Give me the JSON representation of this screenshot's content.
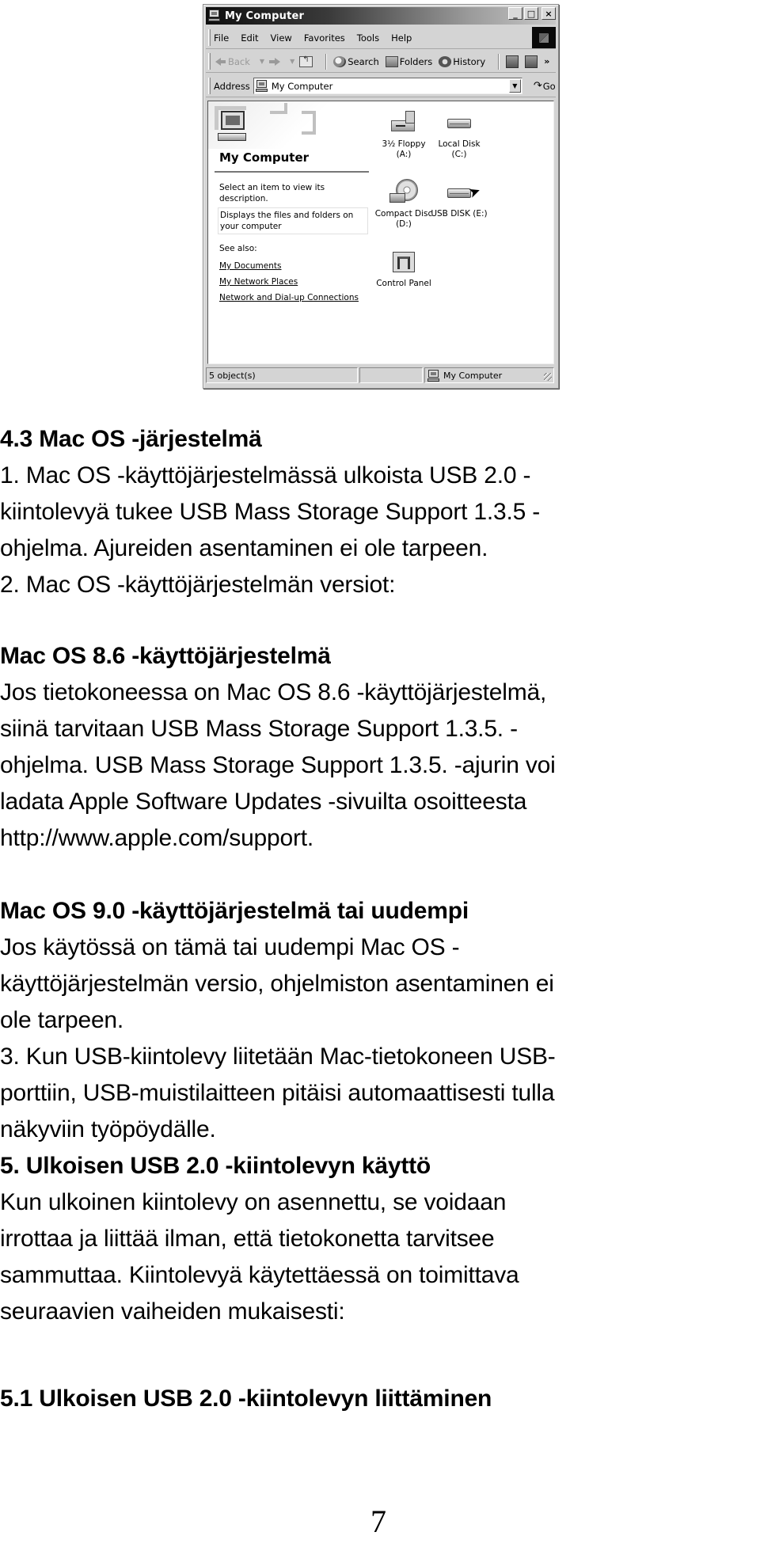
{
  "window": {
    "title": "My Computer",
    "controls": {
      "minimize": "_",
      "maximize": "□",
      "close": "×"
    },
    "menu": [
      "File",
      "Edit",
      "View",
      "Favorites",
      "Tools",
      "Help"
    ],
    "toolbar": {
      "back": "Back",
      "search": "Search",
      "folders": "Folders",
      "history": "History",
      "more": "»"
    },
    "address": {
      "label": "Address",
      "value": "My Computer",
      "go": "Go"
    },
    "left_pane": {
      "title": "My Computer",
      "hint": "Select an item to view its description.",
      "description": "Displays the files and folders on your computer",
      "see_also_label": "See also:",
      "links": [
        "My Documents",
        "My Network Places",
        "Network and Dial-up Connections"
      ]
    },
    "drives": [
      {
        "label": "3½ Floppy (A:)",
        "icon": "floppy-drive-icon"
      },
      {
        "label": "Local Disk (C:)",
        "icon": "hard-disk-icon"
      },
      {
        "label": "Compact Disc (D:)",
        "icon": "cd-drive-icon"
      },
      {
        "label": "USB DISK (E:)",
        "icon": "usb-disk-icon"
      },
      {
        "label": "Control Panel",
        "icon": "control-panel-icon"
      }
    ],
    "status": {
      "objects": "5 object(s)",
      "location": "My Computer"
    }
  },
  "document": {
    "lines": [
      {
        "text": "4.3 Mac OS -järjestelmä",
        "bold": true
      },
      {
        "text": "1. Mac OS -käyttöjärjestelmässä ulkoista USB 2.0 -",
        "bold": false
      },
      {
        "text": "kiintolevyä tukee USB Mass Storage Support 1.3.5 -",
        "bold": false
      },
      {
        "text": "ohjelma. Ajureiden asentaminen ei ole tarpeen.",
        "bold": false
      },
      {
        "text": "2. Mac OS -käyttöjärjestelmän versiot:",
        "bold": false
      },
      {
        "text": "Mac OS 8.6 -käyttöjärjestelmä",
        "bold": true
      },
      {
        "text": "Jos tietokoneessa on Mac OS 8.6 -käyttöjärjestelmä,",
        "bold": false
      },
      {
        "text": "siinä tarvitaan USB Mass Storage Support 1.3.5. -",
        "bold": false
      },
      {
        "text": "ohjelma. USB Mass Storage Support 1.3.5. -ajurin voi",
        "bold": false
      },
      {
        "text": "ladata Apple Software Updates -sivuilta osoitteesta",
        "bold": false
      },
      {
        "text": "http://www.apple.com/support.",
        "bold": false
      },
      {
        "text": "Mac OS 9.0 -käyttöjärjestelmä tai uudempi",
        "bold": true
      },
      {
        "text": "Jos käytössä on tämä tai uudempi Mac OS -",
        "bold": false
      },
      {
        "text": "käyttöjärjestelmän versio, ohjelmiston asentaminen ei",
        "bold": false
      },
      {
        "text": "ole tarpeen.",
        "bold": false
      },
      {
        "text": "3. Kun USB-kiintolevy liitetään Mac-tietokoneen USB-",
        "bold": false
      },
      {
        "text": "porttiin, USB-muistilaitteen pitäisi automaattisesti tulla",
        "bold": false
      },
      {
        "text": "näkyviin työpöydälle.",
        "bold": false
      },
      {
        "text": "5. Ulkoisen USB 2.0 -kiintolevyn käyttö",
        "bold": true
      },
      {
        "text": "Kun ulkoinen kiintolevy on asennettu, se voidaan",
        "bold": false
      },
      {
        "text": "irrottaa ja liittää ilman, että tietokonetta tarvitsee",
        "bold": false
      },
      {
        "text": "sammuttaa. Kiintolevyä käytettäessä on toimittava",
        "bold": false
      },
      {
        "text": "seuraavien vaiheiden mukaisesti:",
        "bold": false
      },
      {
        "text": "5.1 Ulkoisen USB 2.0 -kiintolevyn liittäminen",
        "bold": true
      }
    ],
    "page_number": "7"
  }
}
